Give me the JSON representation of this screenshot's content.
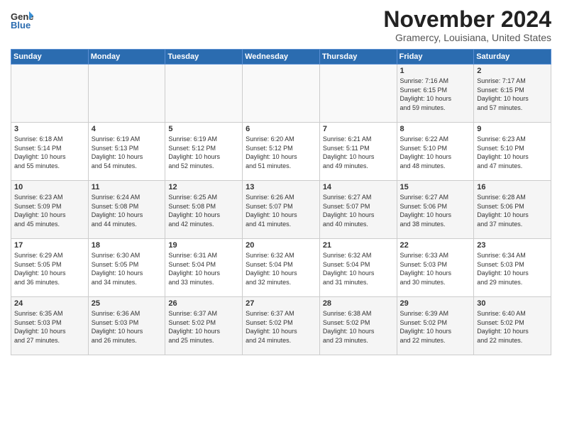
{
  "logo": {
    "line1": "General",
    "line2": "Blue"
  },
  "title": "November 2024",
  "location": "Gramercy, Louisiana, United States",
  "days_of_week": [
    "Sunday",
    "Monday",
    "Tuesday",
    "Wednesday",
    "Thursday",
    "Friday",
    "Saturday"
  ],
  "weeks": [
    [
      {
        "day": "",
        "info": ""
      },
      {
        "day": "",
        "info": ""
      },
      {
        "day": "",
        "info": ""
      },
      {
        "day": "",
        "info": ""
      },
      {
        "day": "",
        "info": ""
      },
      {
        "day": "1",
        "info": "Sunrise: 7:16 AM\nSunset: 6:15 PM\nDaylight: 10 hours\nand 59 minutes."
      },
      {
        "day": "2",
        "info": "Sunrise: 7:17 AM\nSunset: 6:15 PM\nDaylight: 10 hours\nand 57 minutes."
      }
    ],
    [
      {
        "day": "3",
        "info": "Sunrise: 6:18 AM\nSunset: 5:14 PM\nDaylight: 10 hours\nand 55 minutes."
      },
      {
        "day": "4",
        "info": "Sunrise: 6:19 AM\nSunset: 5:13 PM\nDaylight: 10 hours\nand 54 minutes."
      },
      {
        "day": "5",
        "info": "Sunrise: 6:19 AM\nSunset: 5:12 PM\nDaylight: 10 hours\nand 52 minutes."
      },
      {
        "day": "6",
        "info": "Sunrise: 6:20 AM\nSunset: 5:12 PM\nDaylight: 10 hours\nand 51 minutes."
      },
      {
        "day": "7",
        "info": "Sunrise: 6:21 AM\nSunset: 5:11 PM\nDaylight: 10 hours\nand 49 minutes."
      },
      {
        "day": "8",
        "info": "Sunrise: 6:22 AM\nSunset: 5:10 PM\nDaylight: 10 hours\nand 48 minutes."
      },
      {
        "day": "9",
        "info": "Sunrise: 6:23 AM\nSunset: 5:10 PM\nDaylight: 10 hours\nand 47 minutes."
      }
    ],
    [
      {
        "day": "10",
        "info": "Sunrise: 6:23 AM\nSunset: 5:09 PM\nDaylight: 10 hours\nand 45 minutes."
      },
      {
        "day": "11",
        "info": "Sunrise: 6:24 AM\nSunset: 5:08 PM\nDaylight: 10 hours\nand 44 minutes."
      },
      {
        "day": "12",
        "info": "Sunrise: 6:25 AM\nSunset: 5:08 PM\nDaylight: 10 hours\nand 42 minutes."
      },
      {
        "day": "13",
        "info": "Sunrise: 6:26 AM\nSunset: 5:07 PM\nDaylight: 10 hours\nand 41 minutes."
      },
      {
        "day": "14",
        "info": "Sunrise: 6:27 AM\nSunset: 5:07 PM\nDaylight: 10 hours\nand 40 minutes."
      },
      {
        "day": "15",
        "info": "Sunrise: 6:27 AM\nSunset: 5:06 PM\nDaylight: 10 hours\nand 38 minutes."
      },
      {
        "day": "16",
        "info": "Sunrise: 6:28 AM\nSunset: 5:06 PM\nDaylight: 10 hours\nand 37 minutes."
      }
    ],
    [
      {
        "day": "17",
        "info": "Sunrise: 6:29 AM\nSunset: 5:05 PM\nDaylight: 10 hours\nand 36 minutes."
      },
      {
        "day": "18",
        "info": "Sunrise: 6:30 AM\nSunset: 5:05 PM\nDaylight: 10 hours\nand 34 minutes."
      },
      {
        "day": "19",
        "info": "Sunrise: 6:31 AM\nSunset: 5:04 PM\nDaylight: 10 hours\nand 33 minutes."
      },
      {
        "day": "20",
        "info": "Sunrise: 6:32 AM\nSunset: 5:04 PM\nDaylight: 10 hours\nand 32 minutes."
      },
      {
        "day": "21",
        "info": "Sunrise: 6:32 AM\nSunset: 5:04 PM\nDaylight: 10 hours\nand 31 minutes."
      },
      {
        "day": "22",
        "info": "Sunrise: 6:33 AM\nSunset: 5:03 PM\nDaylight: 10 hours\nand 30 minutes."
      },
      {
        "day": "23",
        "info": "Sunrise: 6:34 AM\nSunset: 5:03 PM\nDaylight: 10 hours\nand 29 minutes."
      }
    ],
    [
      {
        "day": "24",
        "info": "Sunrise: 6:35 AM\nSunset: 5:03 PM\nDaylight: 10 hours\nand 27 minutes."
      },
      {
        "day": "25",
        "info": "Sunrise: 6:36 AM\nSunset: 5:03 PM\nDaylight: 10 hours\nand 26 minutes."
      },
      {
        "day": "26",
        "info": "Sunrise: 6:37 AM\nSunset: 5:02 PM\nDaylight: 10 hours\nand 25 minutes."
      },
      {
        "day": "27",
        "info": "Sunrise: 6:37 AM\nSunset: 5:02 PM\nDaylight: 10 hours\nand 24 minutes."
      },
      {
        "day": "28",
        "info": "Sunrise: 6:38 AM\nSunset: 5:02 PM\nDaylight: 10 hours\nand 23 minutes."
      },
      {
        "day": "29",
        "info": "Sunrise: 6:39 AM\nSunset: 5:02 PM\nDaylight: 10 hours\nand 22 minutes."
      },
      {
        "day": "30",
        "info": "Sunrise: 6:40 AM\nSunset: 5:02 PM\nDaylight: 10 hours\nand 22 minutes."
      }
    ]
  ]
}
